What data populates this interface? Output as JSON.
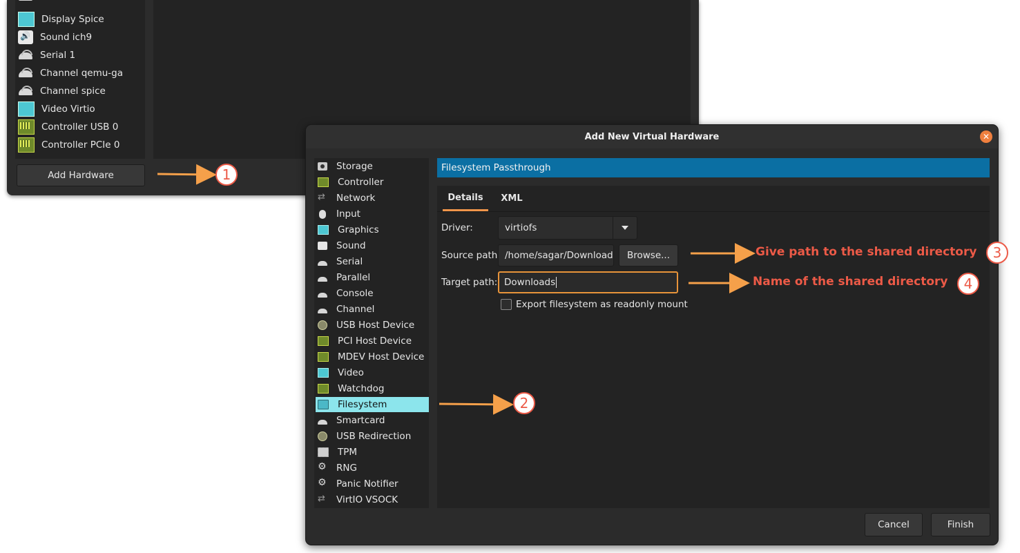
{
  "background_window": {
    "device_list": [
      {
        "label": "Display Spice",
        "icon": "display-icon"
      },
      {
        "label": "Sound ich9",
        "icon": "speaker-icon"
      },
      {
        "label": "Serial 1",
        "icon": "serial-plug-icon"
      },
      {
        "label": "Channel qemu-ga",
        "icon": "serial-plug-icon"
      },
      {
        "label": "Channel spice",
        "icon": "serial-plug-icon"
      },
      {
        "label": "Video Virtio",
        "icon": "display-icon"
      },
      {
        "label": "Controller USB 0",
        "icon": "pci-card-icon"
      },
      {
        "label": "Controller PCIe 0",
        "icon": "pci-card-icon"
      }
    ],
    "add_hardware_label": "Add Hardware"
  },
  "dialog": {
    "title": "Add New Virtual Hardware",
    "close_glyph": "✕",
    "hardware_types": [
      {
        "label": "Storage",
        "icon": "disk-icon"
      },
      {
        "label": "Controller",
        "icon": "pci-card-icon"
      },
      {
        "label": "Network",
        "icon": "network-icon"
      },
      {
        "label": "Input",
        "icon": "mouse-icon"
      },
      {
        "label": "Graphics",
        "icon": "display-icon"
      },
      {
        "label": "Sound",
        "icon": "speaker-icon"
      },
      {
        "label": "Serial",
        "icon": "serial-plug-icon"
      },
      {
        "label": "Parallel",
        "icon": "serial-plug-icon"
      },
      {
        "label": "Console",
        "icon": "serial-plug-icon"
      },
      {
        "label": "Channel",
        "icon": "serial-plug-icon"
      },
      {
        "label": "USB Host Device",
        "icon": "usb-icon"
      },
      {
        "label": "PCI Host Device",
        "icon": "pci-card-icon"
      },
      {
        "label": "MDEV Host Device",
        "icon": "pci-card-icon"
      },
      {
        "label": "Video",
        "icon": "display-icon"
      },
      {
        "label": "Watchdog",
        "icon": "pci-card-icon"
      },
      {
        "label": "Filesystem",
        "icon": "folder-icon"
      },
      {
        "label": "Smartcard",
        "icon": "serial-plug-icon"
      },
      {
        "label": "USB Redirection",
        "icon": "usb-icon"
      },
      {
        "label": "TPM",
        "icon": "chip-icon"
      },
      {
        "label": "RNG",
        "icon": "gear-icon"
      },
      {
        "label": "Panic Notifier",
        "icon": "gear-icon"
      },
      {
        "label": "VirtIO VSOCK",
        "icon": "network-icon"
      }
    ],
    "selected_index": 15,
    "header": "Filesystem Passthrough",
    "tabs": [
      "Details",
      "XML"
    ],
    "active_tab": "Details",
    "form": {
      "driver_label": "Driver:",
      "driver_value": "virtiofs",
      "source_label": "Source path:",
      "source_value": "/home/sagar/Downloads",
      "browse_label": "Browse...",
      "target_label": "Target path:",
      "target_value": "Downloads",
      "readonly_label": "Export filesystem as readonly mount",
      "readonly_checked": false
    },
    "buttons": {
      "cancel": "Cancel",
      "finish": "Finish"
    }
  },
  "annotations": {
    "step1": "1",
    "step2": "2",
    "step3": "3",
    "step4": "4",
    "note3": "Give path to the shared directory",
    "note4": "Name of the shared directory",
    "arrow_color": "#f5a04a",
    "text_color": "#ec5a47"
  },
  "colors": {
    "selection": "#8ce5ec",
    "header_bar": "#0b6fa3",
    "focus_border": "#e8943a",
    "close_button": "#ef7f3e"
  }
}
